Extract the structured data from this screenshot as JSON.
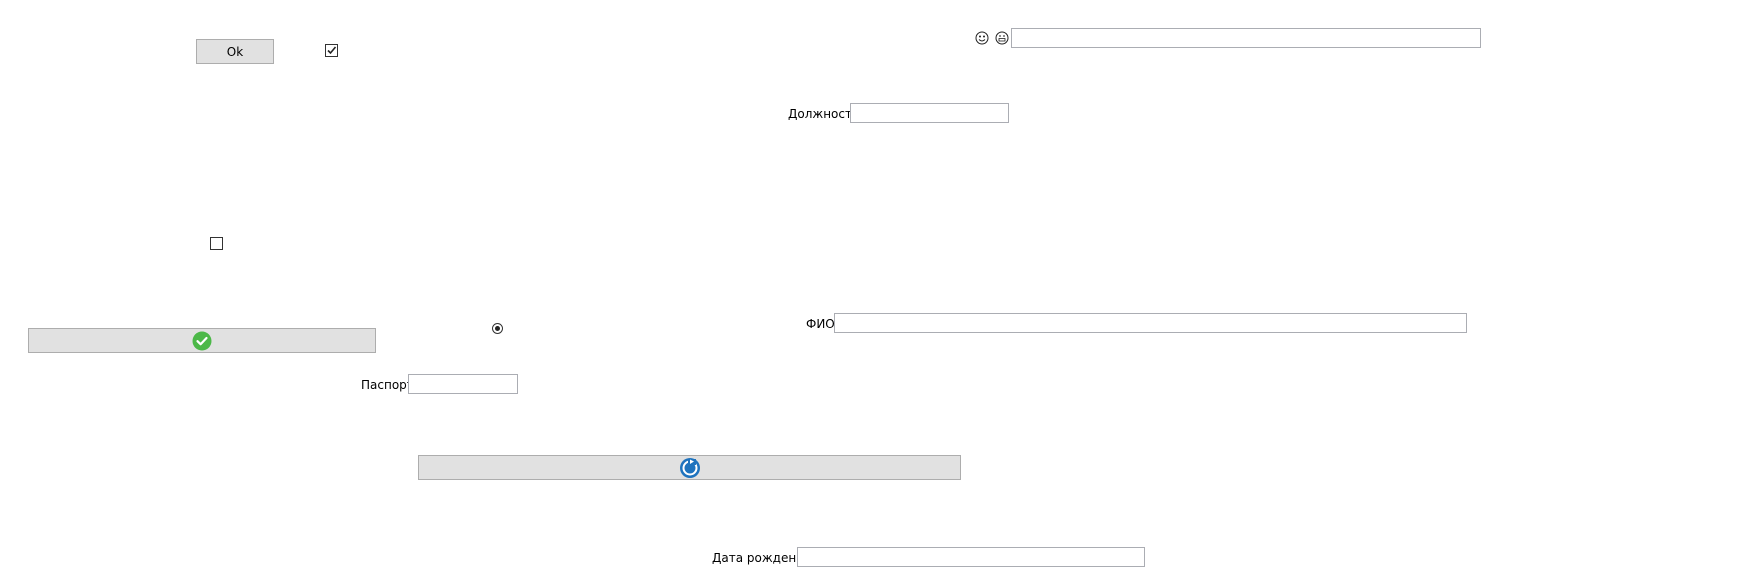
{
  "buttons": {
    "ok_label": "Ok"
  },
  "checkboxes": {
    "top_checked": true,
    "middle_checked": false
  },
  "radio": {
    "selected": true
  },
  "fields": {
    "position_label": "Должность",
    "position_value": "",
    "fio_label": "ФИО",
    "fio_value": "",
    "passport_label": "Паспорт",
    "passport_value": "",
    "birthdate_label": "Дата рождения",
    "birthdate_value": "",
    "top_value": ""
  },
  "icons": {
    "confirm": "check-circle-icon",
    "refresh": "refresh-icon",
    "emoji1": "emoji-face-icon",
    "emoji2": "emoji-grin-icon"
  },
  "colors": {
    "confirm_green": "#4cb848",
    "refresh_blue": "#1e73be",
    "button_bg": "#e1e1e1"
  }
}
